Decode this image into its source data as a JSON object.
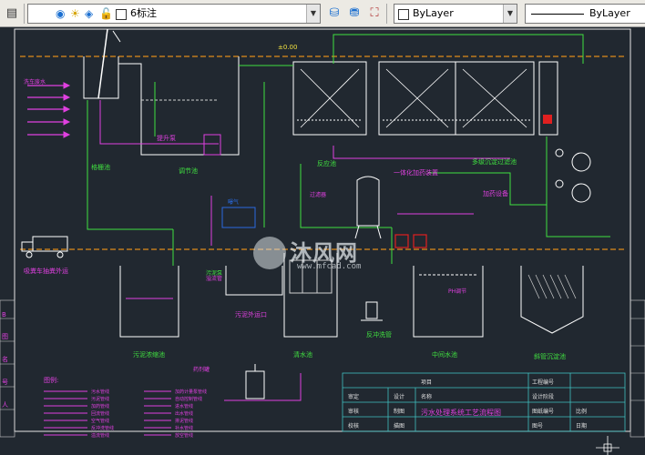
{
  "toolbar": {
    "layer_name": "6标注",
    "color_value": "ByLayer",
    "linetype_value": "ByLayer"
  },
  "drawing": {
    "elevation_mark": "±0.00",
    "source_label": "洗车废水",
    "labels": {
      "tank_grid": "格栅池",
      "tank_regulating": "调节池",
      "tank_reaction": "反应池",
      "tank_multi": "多级沉淀过滤池",
      "tank_reagent": "加药设备",
      "tank_sludge_dry": "污泥浓缩池",
      "tank_clear": "清水池",
      "tank_reuse": "中间水池",
      "tank_inclined": "斜管沉淀池",
      "sludge_pump": "污泥泵",
      "sludge_outlet": "污泥外运口",
      "truck_label": "吸粪车抽粪外运",
      "dosing_device": "一体化加药装置",
      "pump_label": "提升泵",
      "air_label": "曝气",
      "wastewater_inlet": "废水进水管",
      "aeration": "空气管",
      "sludge_return": "污泥回流管",
      "backwash": "反冲洗管",
      "dosing_label": "加药管",
      "filter_label": "过滤器",
      "reagent_tank": "药剂罐",
      "ph_label": "PH调节",
      "overflow": "溢流管"
    },
    "legend": {
      "title": "图例:",
      "col1": [
        "污水管线",
        "污泥管线",
        "加药管线",
        "回流管线",
        "空气管线",
        "反冲洗管线",
        "溢流管线"
      ],
      "col2": [
        "加药计量泵管线",
        "自动控制管线",
        "进水管线",
        "出水管线",
        "排泥管线",
        "补水管线",
        "放空管线"
      ]
    },
    "title_block": {
      "drawing_title": "污水处理系统工艺流程图",
      "cells": [
        "审定",
        "审核",
        "校核",
        "设计",
        "制图",
        "描图",
        "项目",
        "名称",
        "工程编号",
        "设计阶段",
        "图纸编号",
        "图号",
        "比例",
        "日期"
      ]
    },
    "left_tabs": [
      "B",
      "图",
      "名",
      "号",
      "人"
    ]
  },
  "watermark": {
    "text": "沐风网",
    "url": "www.mfcad.com"
  }
}
